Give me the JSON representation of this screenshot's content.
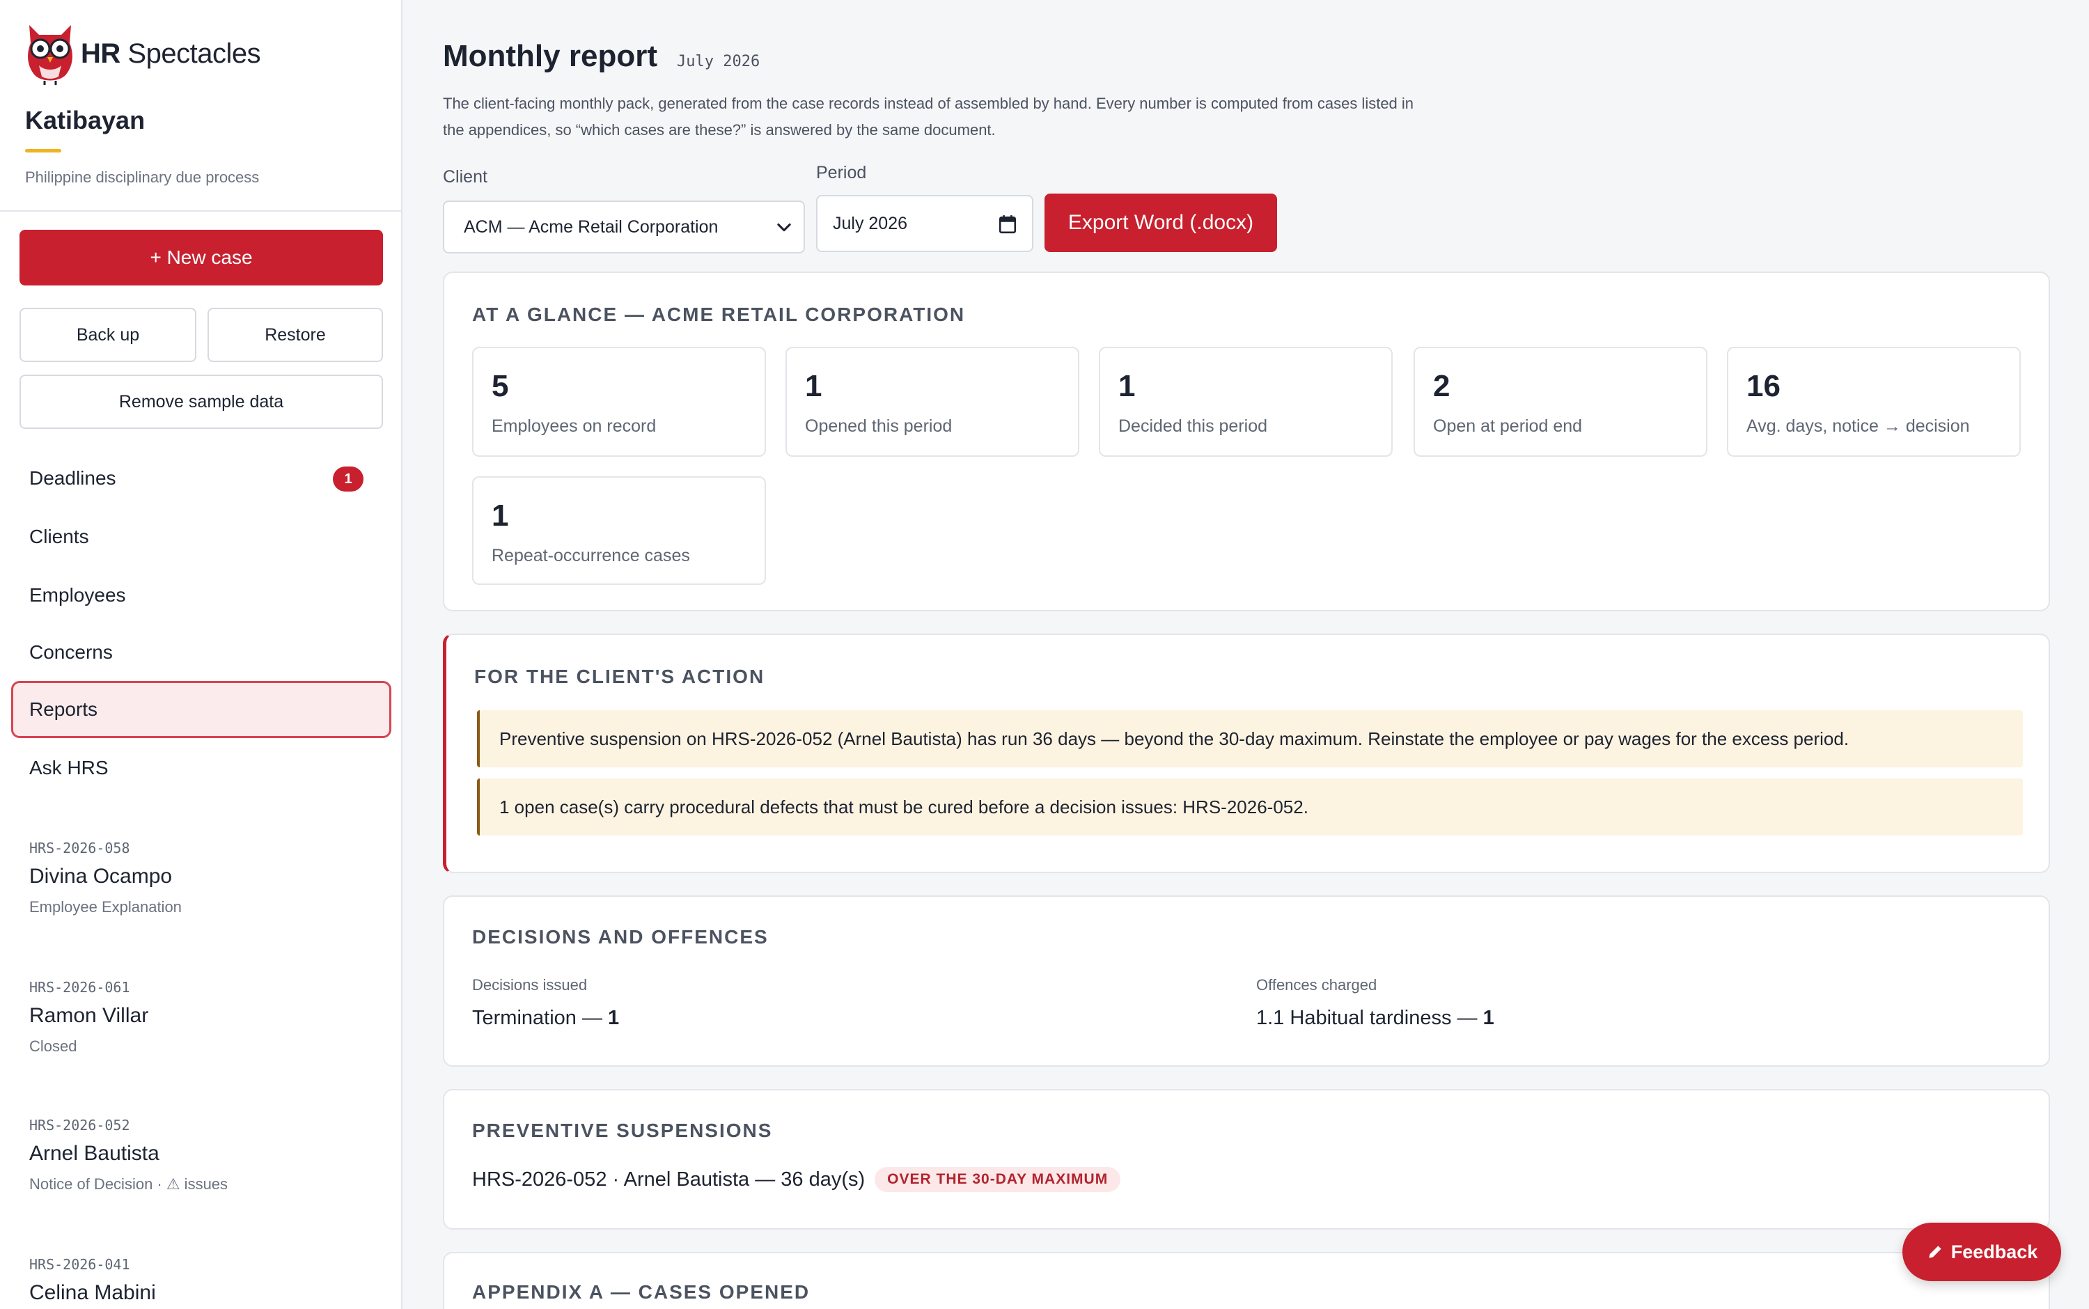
{
  "brand": {
    "name_bold": "HR",
    "name_rest": "Spectacles"
  },
  "org": {
    "title": "Katibayan",
    "subtitle": "Philippine disciplinary due process"
  },
  "sidebar": {
    "new_case_label": "+ New case",
    "backup_label": "Back up",
    "restore_label": "Restore",
    "remove_sample_label": "Remove sample data",
    "nav": [
      {
        "label": "Deadlines",
        "badge": "1"
      },
      {
        "label": "Clients"
      },
      {
        "label": "Employees"
      },
      {
        "label": "Concerns"
      },
      {
        "label": "Reports",
        "active": true
      },
      {
        "label": "Ask HRS"
      }
    ],
    "cases": [
      {
        "id": "HRS-2026-058",
        "name": "Divina Ocampo",
        "status": "Employee Explanation"
      },
      {
        "id": "HRS-2026-061",
        "name": "Ramon Villar",
        "status": "Closed"
      },
      {
        "id": "HRS-2026-052",
        "name": "Arnel Bautista",
        "status": "Notice of Decision · ⚠ issues"
      },
      {
        "id": "HRS-2026-041",
        "name": "Celina Mabini",
        "status": ""
      }
    ]
  },
  "main": {
    "title": "Monthly report",
    "subtitle": "July 2026",
    "description": "The client-facing monthly pack, generated from the case records instead of assembled by hand. Every number is computed from cases listed in the appendices, so “which cases are these?” is answered by the same document.",
    "client_label": "Client",
    "client_value": "ACM — Acme Retail Corporation",
    "period_label": "Period",
    "period_value": "July  2026",
    "export_label": "Export Word (.docx)"
  },
  "glance": {
    "title": "At a glance — Acme Retail Corporation",
    "stats": [
      {
        "value": "5",
        "label": "Employees on record"
      },
      {
        "value": "1",
        "label": "Opened this period"
      },
      {
        "value": "1",
        "label": "Decided this period"
      },
      {
        "value": "2",
        "label": "Open at period end"
      },
      {
        "value": "16",
        "label": "Avg. days, notice → decision"
      },
      {
        "value": "1",
        "label": "Repeat-occurrence cases"
      }
    ]
  },
  "client_action": {
    "title": "For the client's action",
    "items": [
      "Preventive suspension on HRS-2026-052 (Arnel Bautista) has run 36 days — beyond the 30-day maximum. Reinstate the employee or pay wages for the excess period.",
      "1 open case(s) carry procedural defects that must be cured before a decision issues: HRS-2026-052."
    ]
  },
  "decisions": {
    "title": "Decisions and offences",
    "decisions_label": "Decisions issued",
    "decision_name": "Termination —",
    "decision_count": "1",
    "offences_label": "Offences charged",
    "offence_name": "1.1 Habitual tardiness —",
    "offence_count": "1"
  },
  "suspensions": {
    "title": "Preventive suspensions",
    "line": "HRS-2026-052 · Arnel Bautista — 36 day(s)",
    "pill": "OVER THE 30-DAY MAXIMUM"
  },
  "appendix": {
    "title": "Appendix A — Cases opened"
  },
  "feedback_label": "Feedback",
  "colors": {
    "accent": "#c8202e",
    "alert_bg": "#fdf3e1",
    "active_nav_bg": "#fcebec"
  }
}
